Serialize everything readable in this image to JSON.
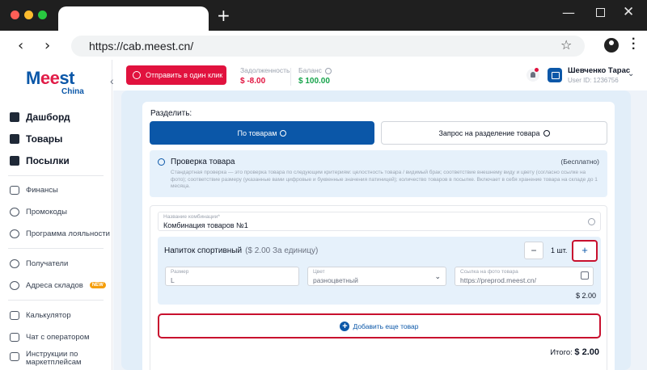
{
  "browser": {
    "url": "https://cab.meest.cn/"
  },
  "logo": {
    "brand": "Meest",
    "sub": "China"
  },
  "sidebar": {
    "primary": [
      {
        "label": "Дашборд"
      },
      {
        "label": "Товары"
      },
      {
        "label": "Посылки"
      }
    ],
    "secondary": [
      {
        "label": "Финансы"
      },
      {
        "label": "Промокоды"
      },
      {
        "label": "Программа лояльности"
      }
    ],
    "tertiary": [
      {
        "label": "Получатели"
      },
      {
        "label": "Адреса складов",
        "badge": "NEW"
      }
    ],
    "bottom": [
      {
        "label": "Калькулятор"
      },
      {
        "label": "Чат с оператором"
      },
      {
        "label_line1": "Инструкции по",
        "label_line2": "маркетплейсам"
      }
    ]
  },
  "header": {
    "send_label": "Отправить в один клик",
    "debt_label": "Задолженность",
    "debt_value": "$ -8.00",
    "balance_label": "Баланс",
    "balance_value": "$ 100.00",
    "user_name": "Шевченко Тарас",
    "user_id": "User ID: 1236756",
    "colors": {
      "debt": "#e1123e",
      "balance": "#16a34a",
      "accent": "#0b57a8"
    }
  },
  "main": {
    "split_label": "Разделить:",
    "split_by_goods": "По товарам",
    "split_request": "Запрос на разделение товара",
    "check": {
      "title": "Проверка товара",
      "price": "(Бесплатно)",
      "description": "Стандартная проверка — это проверка товара по следующим критериям: целостность товара / видимый брак; соответствие внешнему виду и цвету (согласно ссылке на фото); соответствие размеру (указанные вами цифровые и буквенные значения патиницей); количество товаров в посылке. Включает в себя хранение товара на складе до 1 месяца."
    },
    "combo": {
      "label": "Название комбинации*",
      "value": "Комбинация товаров №1"
    },
    "product": {
      "name": "Напиток спортивный",
      "unit_price": "($ 2.00 За единицу)",
      "quantity": "1 шт.",
      "minus": "−",
      "plus": "+",
      "size_label": "Размер",
      "size_value": "L",
      "color_label": "Цвет",
      "color_value": "разноцветный",
      "link_label": "Ссылка на фото товара",
      "link_value": "https://preprod.meest.cn/",
      "line_total": "$ 2.00"
    },
    "add_label": "Добавить еще товар",
    "total_label": "Итого:",
    "total_value": "$ 2.00"
  }
}
